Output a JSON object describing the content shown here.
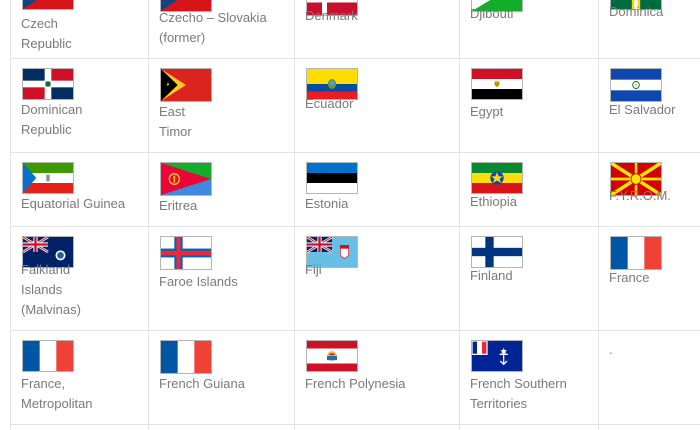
{
  "countries": [
    {
      "name": "Czech Republic",
      "lines": [
        "Czech",
        "Republic"
      ],
      "flag": "czech-republic-flag"
    },
    {
      "name": "Czecho – Slovakia (former)",
      "lines": [
        "Czecho – Slovakia",
        "(former)"
      ],
      "flag": "czechoslovakia-flag"
    },
    {
      "name": "Denmark",
      "lines": [
        "Denmark"
      ],
      "flag": "denmark-flag"
    },
    {
      "name": "Djibouti",
      "lines": [
        "Djibouti"
      ],
      "flag": "djibouti-flag"
    },
    {
      "name": "Dominica",
      "lines": [
        "Dominica"
      ],
      "flag": "dominica-flag"
    },
    {
      "name": "Dominican Republic",
      "lines": [
        "Dominican",
        "Republic"
      ],
      "flag": "dominican-republic-flag"
    },
    {
      "name": "East Timor",
      "lines": [
        "East",
        "Timor"
      ],
      "flag": "east-timor-flag"
    },
    {
      "name": "Ecuador",
      "lines": [
        "Ecuador"
      ],
      "flag": "ecuador-flag"
    },
    {
      "name": "Egypt",
      "lines": [
        "Egypt"
      ],
      "flag": "egypt-flag"
    },
    {
      "name": "El Salvador",
      "lines": [
        "El Salvador"
      ],
      "flag": "el-salvador-flag"
    },
    {
      "name": "Equatorial Guinea",
      "lines": [
        "Equatorial Guinea"
      ],
      "flag": "equatorial-guinea-flag"
    },
    {
      "name": "Eritrea",
      "lines": [
        "Eritrea"
      ],
      "flag": "eritrea-flag"
    },
    {
      "name": "Estonia",
      "lines": [
        "Estonia"
      ],
      "flag": "estonia-flag"
    },
    {
      "name": "Ethiopia",
      "lines": [
        "Ethiopia"
      ],
      "flag": "ethiopia-flag"
    },
    {
      "name": "F.Y.R.O.M.",
      "lines": [
        "F.Y.R.O.M."
      ],
      "flag": "fyrom-flag"
    },
    {
      "name": "Falkland Islands (Malvinas)",
      "lines": [
        "Falkland",
        "Islands",
        "(Malvinas)"
      ],
      "flag": "falkland-islands-flag"
    },
    {
      "name": "Faroe Islands",
      "lines": [
        "Faroe Islands"
      ],
      "flag": "faroe-islands-flag"
    },
    {
      "name": "Fiji",
      "lines": [
        "Fiji"
      ],
      "flag": "fiji-flag"
    },
    {
      "name": "Finland",
      "lines": [
        "Finland"
      ],
      "flag": "finland-flag"
    },
    {
      "name": "France",
      "lines": [
        "France"
      ],
      "flag": "france-flag"
    },
    {
      "name": "France, Metropolitan",
      "lines": [
        "France,",
        "Metropolitan"
      ],
      "flag": "france-metropolitan-flag"
    },
    {
      "name": "French Guiana",
      "lines": [
        "French Guiana"
      ],
      "flag": "french-guiana-flag"
    },
    {
      "name": "French Polynesia",
      "lines": [
        "French Polynesia"
      ],
      "flag": "french-polynesia-flag"
    },
    {
      "name": "French Southern Territories",
      "lines": [
        "French Southern",
        "Territories"
      ],
      "flag": "french-southern-territories-flag"
    },
    {
      "name": ".",
      "lines": [
        "."
      ],
      "flag": null
    }
  ]
}
